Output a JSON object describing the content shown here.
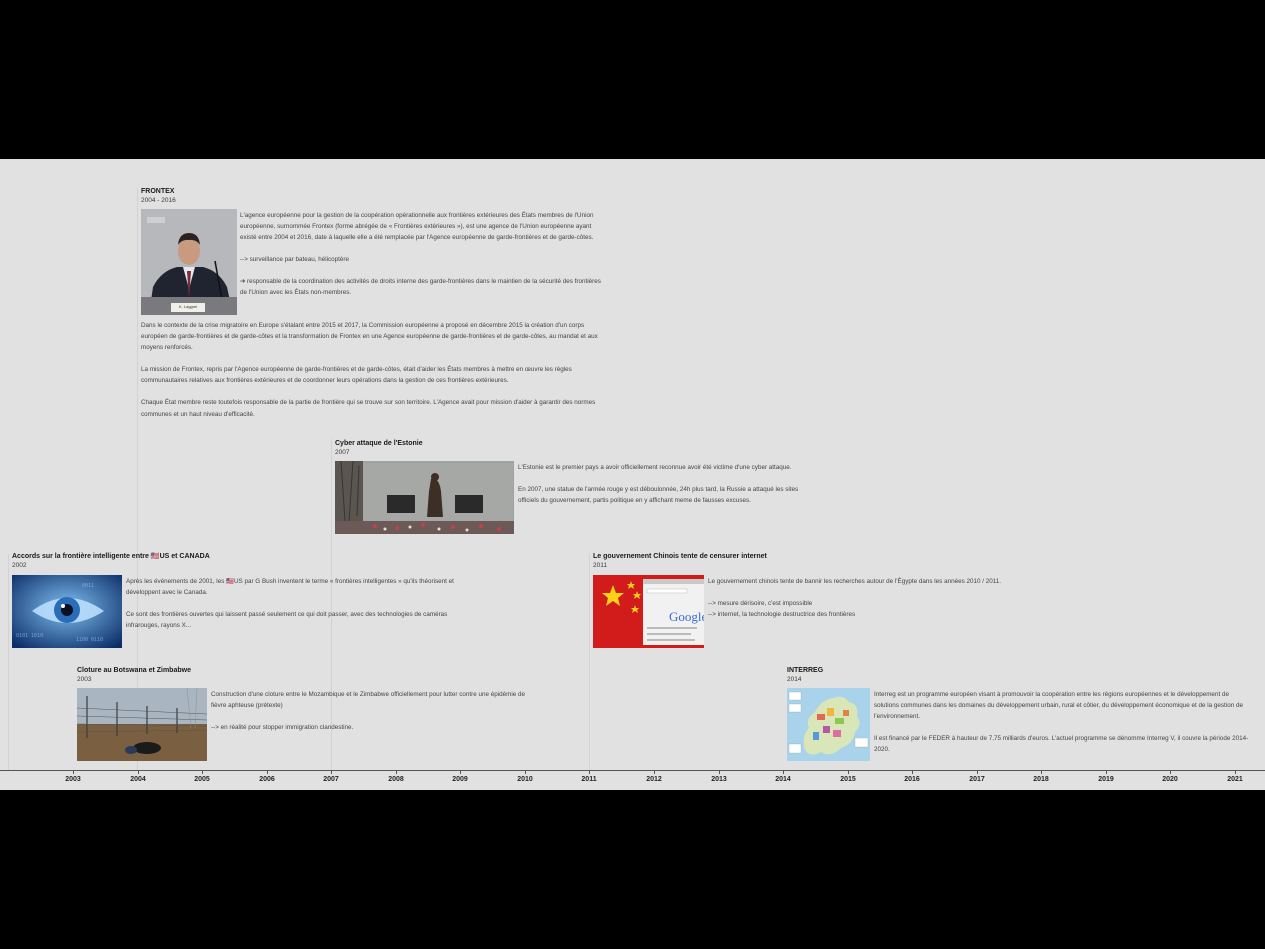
{
  "events": {
    "frontex": {
      "title": "FRONTEX",
      "date": "2004 - 2016",
      "p1": "L'agence européenne pour la gestion de la coopération opérationnelle aux frontières extérieures des États membres de l'Union européenne, surnommée Frontex (forme abrégée de « Frontières extérieures »), est une agence de l'Union européenne ayant existé entre 2004 et 2016, date à laquelle elle a été remplacée par l'Agence européenne de garde-frontières et de garde-côtes.",
      "p2": "--> surveillance par bateau, hélicoptère",
      "p3": "➔ responsable de la coordination des activités de droits interne des garde-frontières dans le maintien de la sécurité des frontières de l'Union avec les États non-membres.",
      "p4": "Dans le contexte de la crise migratoire en Europe s'étalant entre 2015 et 2017, la Commission européenne a proposé en décembre 2015 la création d'un corps européen de garde-frontières et de garde-côtes et la transformation de Frontex en une Agence européenne de garde-frontières et de garde-côtes, au mandat et aux moyens renforcés.",
      "p5": "La mission de Frontex, repris par l'Agence européenne de garde-frontières et de garde-côtes, était d'aider les États membres à mettre en œuvre les règles communautaires relatives aux frontières extérieures et de coordonner leurs opérations dans la gestion de ces frontières extérieures.",
      "p6": "Chaque État membre reste toutefois responsable de la partie de frontière qui se trouve sur son territoire. L'Agence avait pour mission d'aider à garantir des normes communes et un haut niveau d'efficacité.",
      "nameplate": "K. Laggmi"
    },
    "estonie": {
      "title": "Cyber attaque de l'Estonie",
      "date": "2007",
      "p1": "L'Estonie est le premier pays a avoir officiellement reconnue avoir été victime d'une cyber attaque.",
      "p2": "En 2007, une statue de l'armée rouge y est déboulonnée, 24h plus tard, la Russie a attaqué les sites officiels du gouvernement, partis politique en y affichant meme de fausses excuses."
    },
    "accords": {
      "title": "Accords sur la frontière intelligente entre 🇺🇸US et CANADA",
      "date": "2002",
      "p1": "Après les événements de 2001, les 🇺🇸US par G Bush inventent le terme « frontières intelligentes » qu'ils théorisent et développent avec le Canada.",
      "p2": "Ce sont des frontières ouvertes qui laissent passé seulement ce qui doit passer, avec des technologies de caméras infrarouges, rayons X..."
    },
    "chine": {
      "title": "Le gouvernement Chinois tente de censurer internet",
      "date": "2011",
      "p1": "Le gouvernement chinois tente de bannir les recherches autour de l'Égypte dans les années 2010 / 2011.",
      "p2": "--> mesure dérisoire, c'est impossible",
      "p3": "--> internet, la technologie destructrice des frontières",
      "logo": "Google"
    },
    "botswana": {
      "title": "Cloture au Botswana et Zimbabwe",
      "date": "2003",
      "p1": "Construction d'une cloture entre le Mozambique et le Zimbabwe officiellement pour lutter contre une épidémie de fièvre aphteuse (prétexte)",
      "p2": "--> en réalité pour stopper immigration clandestine."
    },
    "interreg": {
      "title": "INTERREG",
      "date": "2014",
      "p1": "Interreg est un programme européen visant à promouvoir la coopération entre les régions européennes et le développement de solutions communes dans les domaines du développement urbain, rural et côtier, du développement économique et de la gestion de l'environnement.",
      "p2": "Il est financé par le FEDER à hauteur de 7,75 milliards d'euros. L'actuel programme se dénomme Interreg V, il couvre la période 2014-2020."
    }
  },
  "timeline": {
    "years": [
      "2003",
      "2004",
      "2005",
      "2006",
      "2007",
      "2008",
      "2009",
      "2010",
      "2011",
      "2012",
      "2013",
      "2014",
      "2015",
      "2016",
      "2017",
      "2018",
      "2019",
      "2020",
      "2021"
    ]
  },
  "colors": {
    "background": "#e1e1e1",
    "letterbox": "#000000"
  }
}
